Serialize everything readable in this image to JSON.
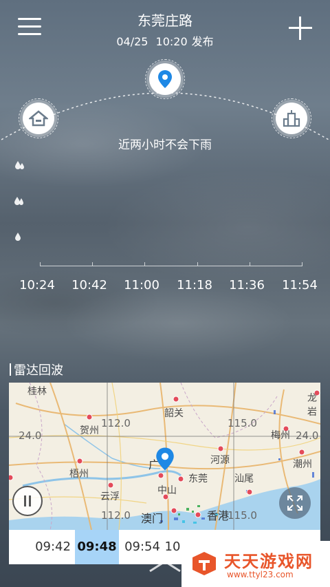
{
  "header": {
    "title": "东莞庄路",
    "date": "04/25",
    "time": "10:20",
    "publish_suffix": "发布"
  },
  "forecast": {
    "summary": "近两小时不会下雨",
    "time_ticks": [
      "10:24",
      "10:42",
      "11:00",
      "11:18",
      "11:36",
      "11:54"
    ]
  },
  "radar": {
    "section_title": "雷达回波",
    "map_labels": {
      "guilin": "桂林",
      "shaoguan": "韶关",
      "hezhou": "贺州",
      "wuzhou": "梧州",
      "yunfu": "云浮",
      "guangzhou": "广",
      "zhongshan": "中山",
      "dongguan": "东莞",
      "heyuan": "河源",
      "meizhou": "梅州",
      "chaozhou": "潮州",
      "longyan": "龙岩",
      "shanwei": "汕尾",
      "macau": "澳门",
      "hongkong": "香港"
    },
    "grid_labels": {
      "lat24": "24.0",
      "lat24_right": "24.0",
      "lon112": "112.0",
      "lon115": "115.0",
      "lon112_bottom": "112.0",
      "lon115_bottom": "115.0"
    },
    "timeline": [
      "09:42",
      "09:48",
      "09:54",
      "10"
    ],
    "active_index": 1
  },
  "watermark": {
    "name": "天天游戏网",
    "url": "www.ttyl23.com"
  },
  "colors": {
    "accent": "#1e88e5",
    "timeline_active": "#a7d4f7",
    "watermark": "#e8552a"
  },
  "icons": {
    "menu": "menu-icon",
    "add": "plus-icon",
    "home": "home-icon",
    "location": "location-pin-icon",
    "building": "building-icon",
    "rain_drop": "raindrop-icon",
    "pause": "pause-icon",
    "expand": "expand-icon",
    "chevron": "chevron-up-icon"
  }
}
